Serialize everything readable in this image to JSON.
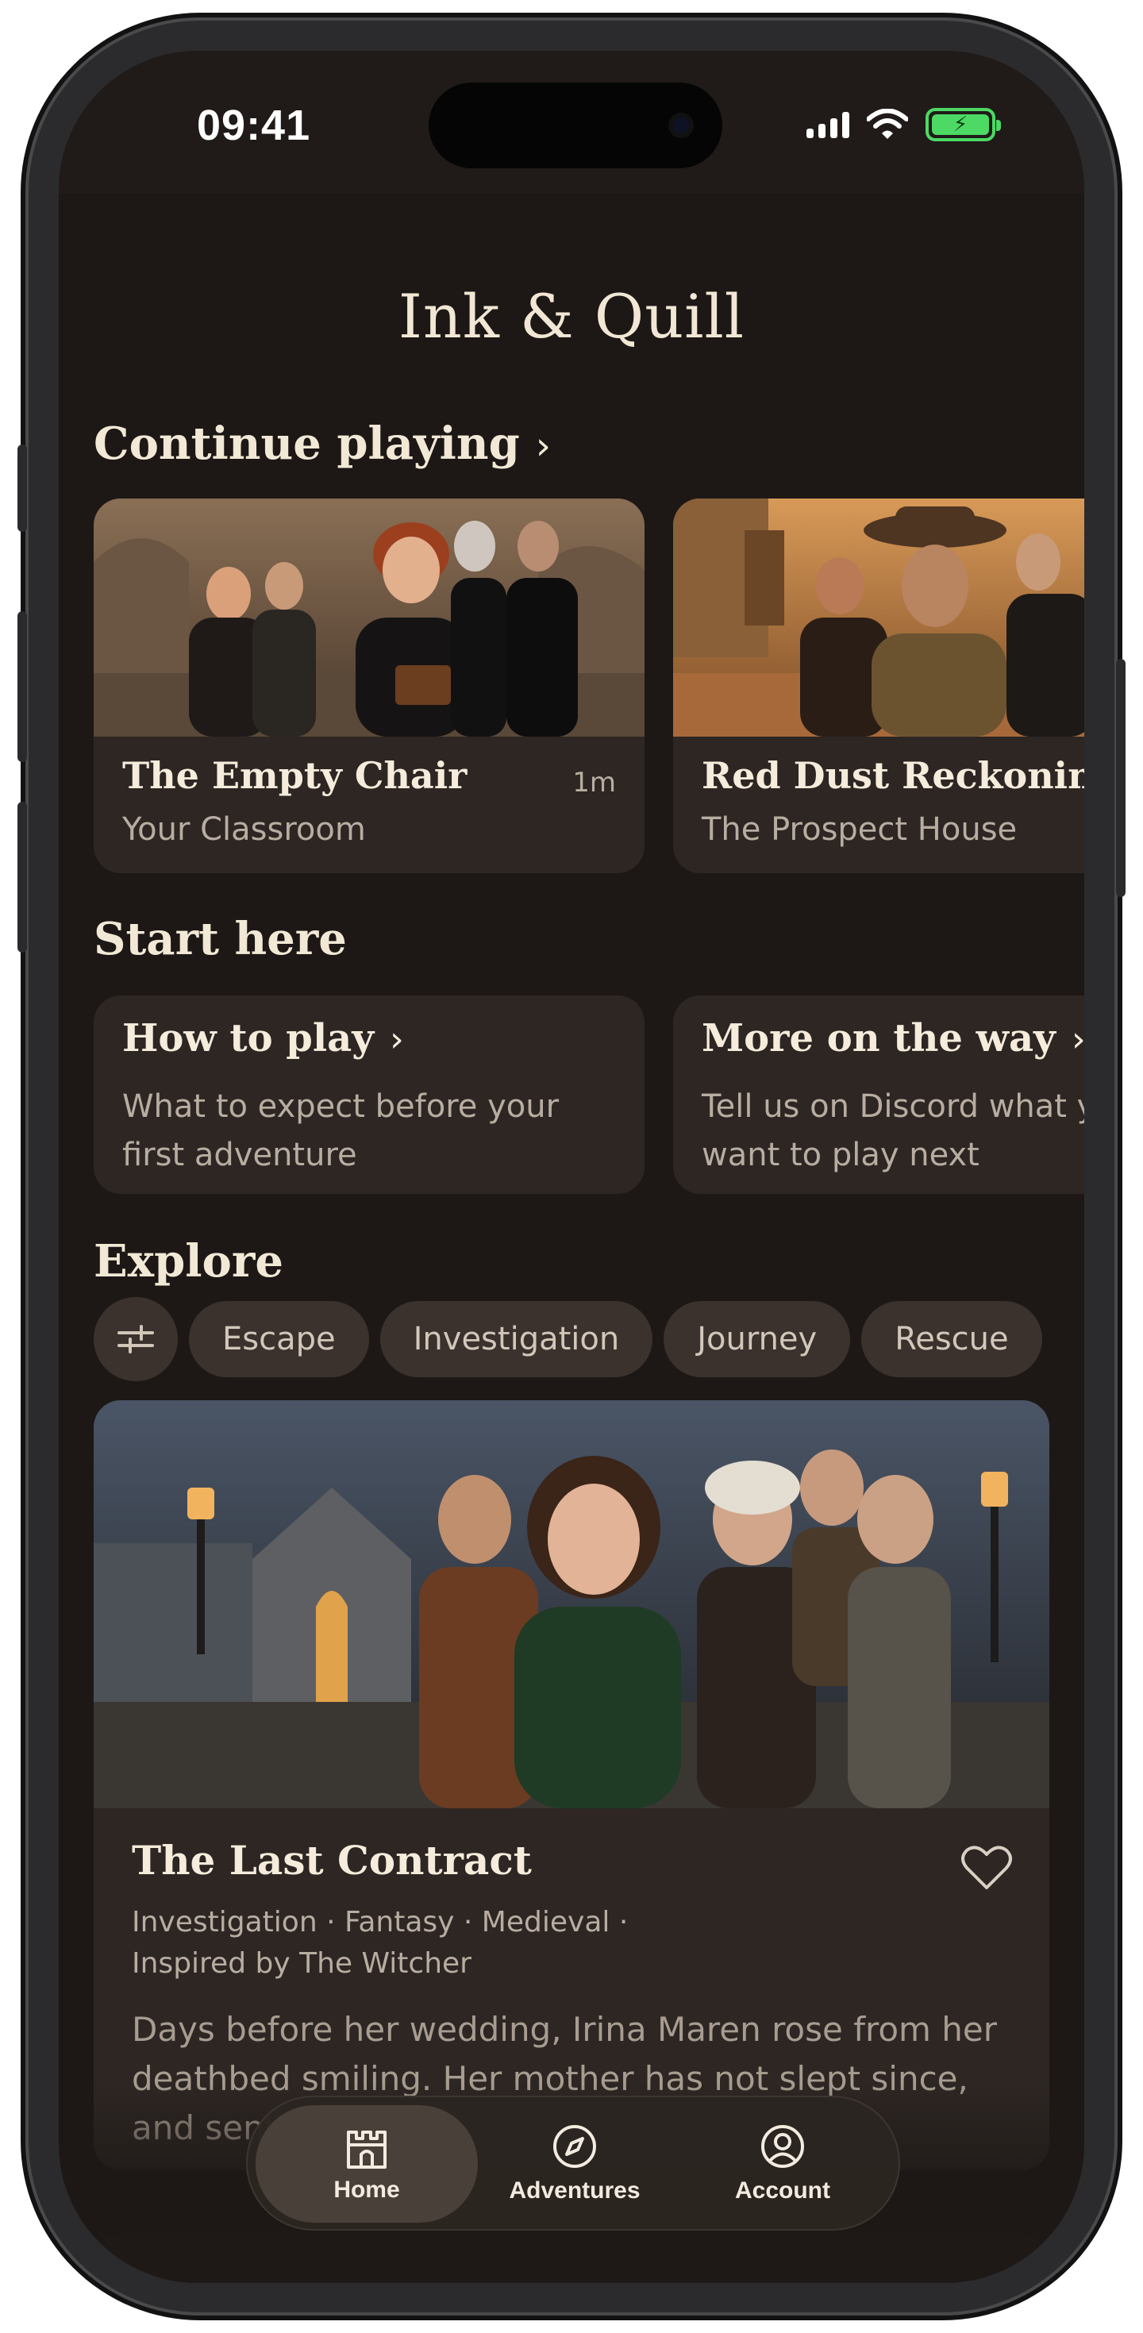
{
  "status_bar": {
    "time": "09:41"
  },
  "app": {
    "logo": "Ink & Quill"
  },
  "continue_playing": {
    "title": "Continue playing",
    "cards": [
      {
        "title": "The Empty Chair",
        "subtitle": "Your Classroom",
        "time": "1m"
      },
      {
        "title": "Red Dust Reckoning",
        "subtitle": "The Prospect House"
      }
    ]
  },
  "start_here": {
    "title": "Start here",
    "cards": [
      {
        "title": "How to play",
        "desc": "What to expect before your first adventure"
      },
      {
        "title": "More on the way",
        "desc": "Tell us on Discord what you want to play next"
      }
    ]
  },
  "explore": {
    "title": "Explore",
    "chips": [
      "Escape",
      "Investigation",
      "Journey",
      "Rescue"
    ],
    "featured": {
      "title": "The Last Contract",
      "tags": "Investigation · Fantasy · Medieval · Inspired by The Witcher",
      "desc": "Days before her wedding, Irina Maren rose from her deathbed smiling. Her mother has not slept since, and sent for you."
    }
  },
  "tabbar": {
    "tabs": [
      {
        "label": "Home",
        "icon": "castle-icon",
        "active": true
      },
      {
        "label": "Adventures",
        "icon": "compass-icon",
        "active": false
      },
      {
        "label": "Account",
        "icon": "user-circle-icon",
        "active": false
      }
    ]
  },
  "colors": {
    "background": "#1d1816",
    "card": "#2d2623",
    "chip": "#3b322d",
    "text": "#f5ecdc",
    "muted": "#b8ada1",
    "battery": "#4cd964"
  }
}
